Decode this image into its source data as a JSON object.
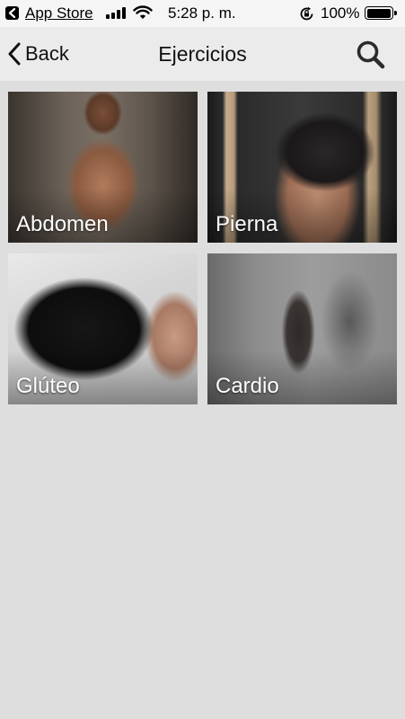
{
  "status_bar": {
    "back_app": "App Store",
    "time": "5:28 p. m.",
    "battery": "100%"
  },
  "nav": {
    "back_label": "Back",
    "title": "Ejercicios"
  },
  "tiles": [
    {
      "label": "Abdomen"
    },
    {
      "label": "Pierna"
    },
    {
      "label": "Glúteo"
    },
    {
      "label": "Cardio"
    }
  ],
  "icons": {
    "back": "chevron-left-icon",
    "search": "search-icon"
  },
  "colors": {
    "background": "#dedede",
    "nav_bar": "#ebebeb",
    "status_bar": "#f5f5f5",
    "tile_text": "#ffffff"
  }
}
